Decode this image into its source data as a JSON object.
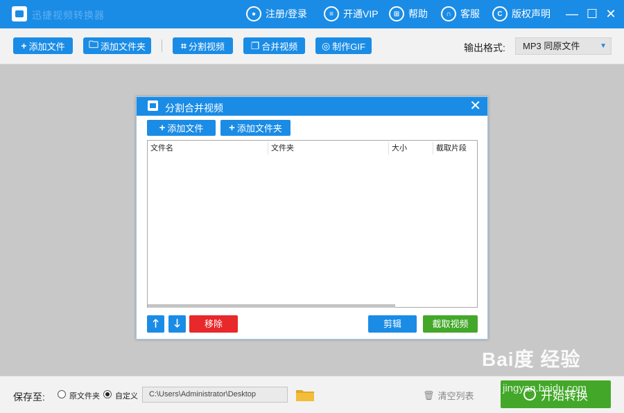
{
  "titlebar": {
    "app_title": "迅捷视频转换器",
    "items": [
      {
        "label": "注册/登录",
        "icon": "user-icon"
      },
      {
        "label": "开通VIP",
        "icon": "vip-icon"
      },
      {
        "label": "帮助",
        "icon": "help-icon"
      },
      {
        "label": "客服",
        "icon": "headset-icon"
      },
      {
        "label": "版权声明",
        "icon": "copyright-icon"
      }
    ],
    "window_controls": {
      "minimize": "—",
      "maximize": "☐",
      "close": "✕"
    }
  },
  "toolbar": {
    "buttons": [
      {
        "label": "添加文件",
        "icon": "plus-icon",
        "glyph": "+"
      },
      {
        "label": "添加文件夹",
        "icon": "folder-icon",
        "glyph": "🗀"
      },
      {
        "label": "分割视频",
        "icon": "crop-icon",
        "glyph": "⌗"
      },
      {
        "label": "合并视频",
        "icon": "merge-icon",
        "glyph": "❐"
      },
      {
        "label": "制作GIF",
        "icon": "gif-icon",
        "glyph": "◎"
      }
    ],
    "format_label": "输出格式:",
    "format_value": "MP3  同原文件",
    "format_arrow": "▼"
  },
  "dialog": {
    "title": "分割合并视频",
    "close": "✕",
    "add_file": "添加文件",
    "add_folder": "添加文件夹",
    "add_glyph": "+",
    "columns": [
      "文件名",
      "文件夹",
      "大小",
      "截取片段"
    ],
    "rows": [],
    "up_glyph": "🡑",
    "down_glyph": "🡓",
    "remove": "移除",
    "edit": "剪辑",
    "capture": "截取视频"
  },
  "bottombar": {
    "save_label": "保存至:",
    "radio_original": "原文件夹",
    "radio_custom": "自定义",
    "selected": "custom",
    "path": "C:\\Users\\Administrator\\Desktop",
    "clear_list": "清空列表",
    "clear_glyph": "🗑",
    "start": "开始转换"
  },
  "watermark": {
    "main": "Bai度 经验",
    "sub": "jingyan.baidu.com"
  },
  "colors": {
    "accent": "#1a8ce6",
    "danger": "#e8282b",
    "success": "#43a829"
  }
}
